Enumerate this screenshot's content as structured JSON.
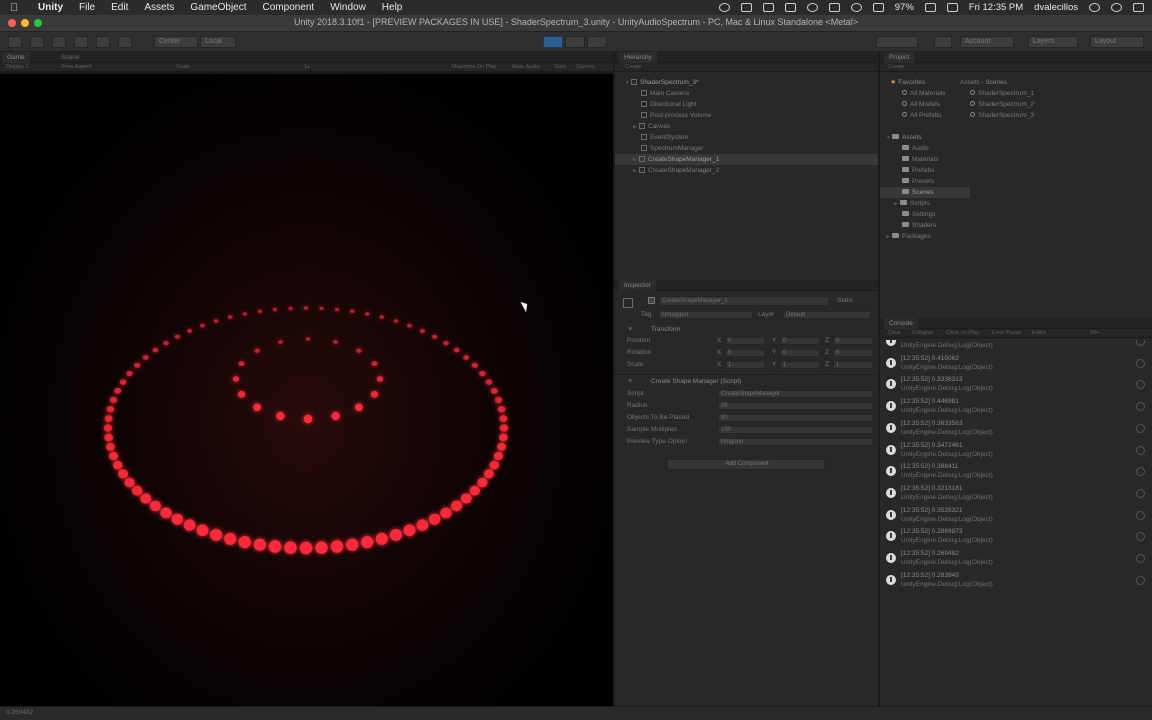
{
  "menubar": {
    "apple": "",
    "app_name": "Unity",
    "menus": [
      "File",
      "Edit",
      "Assets",
      "GameObject",
      "Component",
      "Window",
      "Help"
    ],
    "battery": "97%",
    "clock": "Fri 12:35 PM",
    "user": "dvalecillos"
  },
  "window": {
    "title": "Unity 2018.3.10f1 - [PREVIEW PACKAGES IN USE] - ShaderSpectrum_3.unity - UnityAudioSpectrum - PC, Mac & Linux Standalone <Metal>"
  },
  "toolbar": {
    "center": "Center",
    "local": "Local",
    "account": "Account",
    "layers": "Layers",
    "layout": "Layout"
  },
  "game": {
    "tabs": [
      "Game",
      "Scene"
    ],
    "display": "Display 1",
    "aspect": "Free Aspect",
    "scale": "Scale",
    "scale_value": "1x",
    "maximize": "Maximize On Play",
    "mute": "Mute Audio",
    "stats": "Stats",
    "gizmos": "Gizmos"
  },
  "hierarchy": {
    "tab": "Hierarchy",
    "create": "Create",
    "scene": "ShaderSpectrum_3*",
    "items": [
      "Main Camera",
      "Directional Light",
      "Post-process Volume",
      "Canvas",
      "EventSystem",
      "SpectrumManager",
      "CreateShapeManager_1",
      "CreateShapeManager_2"
    ]
  },
  "project": {
    "tab": "Project",
    "create": "Create",
    "favorites_title": "Favorites",
    "favorites": [
      "All Materials",
      "All Models",
      "All Prefabs"
    ],
    "assets_title": "Assets",
    "asset_folders": [
      "Audio",
      "Materials",
      "Prefabs",
      "Presets",
      "Scenes",
      "Scripts",
      "Settings",
      "Shaders"
    ],
    "packages": "Packages",
    "breadcrumb_root": "Assets",
    "breadcrumb_sep": "›",
    "breadcrumb_leaf": "Scenes",
    "scenes": [
      "ShaderSpectrum_1",
      "ShaderSpectrum_2",
      "ShaderSpectrum_3"
    ]
  },
  "inspector": {
    "tab": "Inspector",
    "object_name": "CreateShapeManager_1",
    "static": "Static",
    "tag_label": "Tag",
    "tag_value": "Untagged",
    "layer_label": "Layer",
    "layer_value": "Default",
    "transform_title": "Transform",
    "position_label": "Position",
    "rotation_label": "Rotation",
    "scale_label": "Scale",
    "position": {
      "x": "0",
      "y": "0",
      "z": "0"
    },
    "rotation": {
      "x": "0",
      "y": "0",
      "z": "0"
    },
    "scale": {
      "x": "1",
      "y": "1",
      "z": "1"
    },
    "script_title": "Create Shape Manager (Script)",
    "script_label": "Script",
    "script_value": "CreateShapeManager",
    "radius_label": "Radius",
    "radius_value": "25",
    "objects_label": "Objects To Be Placed",
    "objects_value": "80",
    "sample_label": "Sample Multiplier",
    "sample_value": "150",
    "preview_label": "Preview Type Option",
    "preview_value": "Ninguno",
    "add_component": "Add Component"
  },
  "console": {
    "tab": "Console",
    "clear": "Clear",
    "collapse": "Collapse",
    "clear_on_play": "Clear on Play",
    "error_pause": "Error Pause",
    "editor": "Editor",
    "count": "99+",
    "entries": [
      {
        "line1": "",
        "line2": "UnityEngine.Debug:Log(Object)"
      },
      {
        "line1": "[12:35:52] 0.415062",
        "line2": "UnityEngine.Debug:Log(Object)"
      },
      {
        "line1": "[12:35:52] 0.3338313",
        "line2": "UnityEngine.Debug:Log(Object)"
      },
      {
        "line1": "[12:35:52] 0.446981",
        "line2": "UnityEngine.Debug:Log(Object)"
      },
      {
        "line1": "[12:35:52] 0.3633563",
        "line2": "UnityEngine.Debug:Log(Object)"
      },
      {
        "line1": "[12:35:52] 0.3472461",
        "line2": "UnityEngine.Debug:Log(Object)"
      },
      {
        "line1": "[12:35:52] 0.398411",
        "line2": "UnityEngine.Debug:Log(Object)"
      },
      {
        "line1": "[12:35:52] 0.3213181",
        "line2": "UnityEngine.Debug:Log(Object)"
      },
      {
        "line1": "[12:35:52] 0.3528321",
        "line2": "UnityEngine.Debug:Log(Object)"
      },
      {
        "line1": "[12:35:52] 0.2869873",
        "line2": "UnityEngine.Debug:Log(Object)"
      },
      {
        "line1": "[12:35:52] 0.269482",
        "line2": "UnityEngine.Debug:Log(Object)"
      },
      {
        "line1": "[12:35:52] 0.283949",
        "line2": "UnityEngine.Debug:Log(Object)"
      }
    ]
  },
  "status": {
    "text": "0.269482"
  },
  "colors": {
    "glow": "#ff2b3a",
    "accent_blue": "#2f5d8f",
    "star": "#c9a23a"
  },
  "scene_shapes": {
    "outer_ring_count": 80,
    "inner_ring_count": 16
  }
}
